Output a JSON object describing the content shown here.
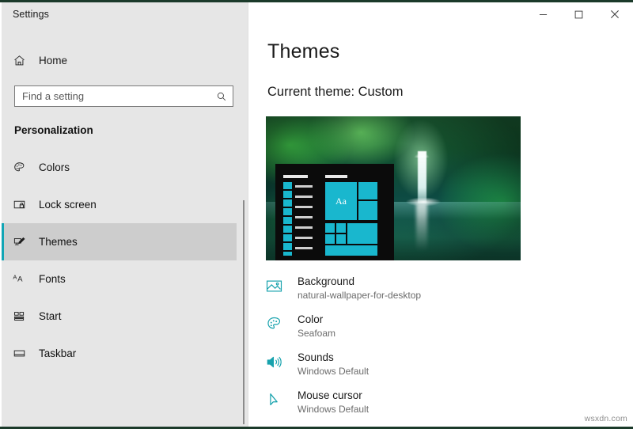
{
  "window": {
    "app_title": "Settings",
    "controls": [
      {
        "name": "minimize",
        "glyph": "─"
      },
      {
        "name": "maximize",
        "glyph": "□"
      },
      {
        "name": "close",
        "glyph": "✕"
      }
    ]
  },
  "sidebar": {
    "home_label": "Home",
    "home_icon": "home-icon",
    "search": {
      "placeholder": "Find a setting",
      "value": "",
      "icon": "search-icon"
    },
    "section_title": "Personalization",
    "items": [
      {
        "label": "Colors",
        "icon": "palette-icon",
        "selected": false
      },
      {
        "label": "Lock screen",
        "icon": "lock-screen-icon",
        "selected": false
      },
      {
        "label": "Themes",
        "icon": "themes-icon",
        "selected": true
      },
      {
        "label": "Fonts",
        "icon": "fonts-icon",
        "selected": false
      },
      {
        "label": "Start",
        "icon": "start-icon",
        "selected": false
      },
      {
        "label": "Taskbar",
        "icon": "taskbar-icon",
        "selected": false
      }
    ]
  },
  "main": {
    "page_title": "Themes",
    "current_theme": "Current theme: Custom",
    "preview": {
      "name": "theme-preview",
      "tile_text": "Aa"
    },
    "settings": [
      {
        "title": "Background",
        "value": "natural-wallpaper-for-desktop",
        "icon": "picture-icon"
      },
      {
        "title": "Color",
        "value": "Seafoam",
        "icon": "palette-icon"
      },
      {
        "title": "Sounds",
        "value": "Windows Default",
        "icon": "speaker-icon"
      },
      {
        "title": "Mouse cursor",
        "value": "Windows Default",
        "icon": "cursor-icon"
      }
    ]
  },
  "watermark": "wsxdn.com",
  "colors": {
    "accent_teal": "#17a2ad",
    "selection_bar": "#11a5b5",
    "sidebar_bg": "#e6e6e6",
    "selected_row_bg": "#cdcdcd",
    "tile_teal": "#19b7ce",
    "frame_green": "#1b3a2a"
  }
}
